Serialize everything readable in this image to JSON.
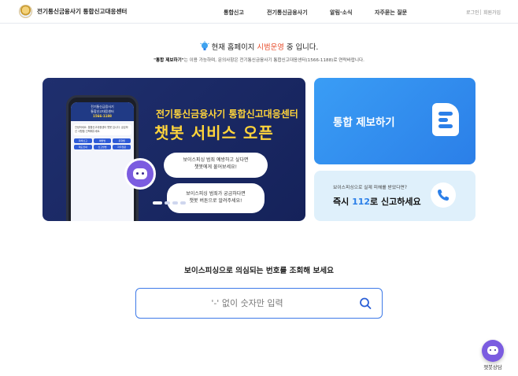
{
  "header": {
    "logo_text": "전기통신금융사기 통합신고대응센터",
    "nav": [
      "통합신고",
      "전기통신금융사기",
      "알림·소식",
      "자주묻는 질문"
    ],
    "login": "로그인",
    "signup": "회원가입"
  },
  "notice": {
    "pre": "현재 홈페이지 ",
    "highlight": "시범운영",
    "post": " 중 입니다.",
    "sub_bold": "\"통합 제보하기\"",
    "sub_rest": "는 이용 가능하며, 문의사항은 전기통신금융사기 통합신고대응센터(1566-1188)로 연락바랍니다."
  },
  "banner": {
    "title1": "전기통신금융사기 통합신고대응센터",
    "title2": "챗봇 서비스 오픈",
    "bubble1": [
      "보이스피싱 범죄 예방하고 싶다면",
      "챗봇에게 물어보세요!"
    ],
    "bubble2": [
      "보이스피싱 범죄가 궁금하다면",
      "챗봇 버튼으로 알려주세요!"
    ],
    "phone_header": [
      "전기통신금융사기",
      "통합신고대응센터",
      "1566-1188"
    ],
    "phone_message": "안녕하세요. 통합신고대응센터 챗봇 입니다. 궁금하신 사항을 선택해주세요.",
    "phone_buttons": [
      "피해신고",
      "예방법",
      "유형별",
      "제도안내",
      "신고방법",
      "자주질문"
    ]
  },
  "report_card": {
    "label": "통합 제보하기"
  },
  "call_card": {
    "sub": "보이스피싱으로 실제 피해를 받았다면?",
    "main_pre": "즉시 ",
    "main_number": "112",
    "main_post": "로 신고하세요"
  },
  "search": {
    "title": "보이스피싱으로 의심되는 번호를 조회해 보세요",
    "placeholder": "'-' 없이 숫자만 입력",
    "value": ""
  },
  "chatbot": {
    "label": "챗봇상담"
  },
  "colors": {
    "brand_blue": "#2b7fe8",
    "banner_navy": "#1f2f6e",
    "highlight_orange": "#e8502f",
    "banner_yellow": "#ffd43b",
    "chatbot_purple": "#7b5ce0"
  },
  "icons": [
    "emblem-logo",
    "notice-bulb-icon",
    "chatbot-robot-icon",
    "report-document-icon",
    "phone-icon",
    "search-icon"
  ]
}
